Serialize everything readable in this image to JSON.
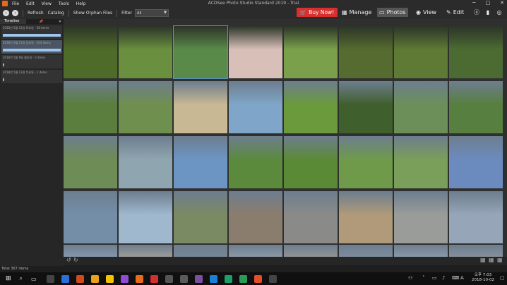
{
  "window": {
    "title": "ACDSee Photo Studio Standard 2019 - Trial",
    "menu": [
      "File",
      "Edit",
      "View",
      "Tools",
      "Help"
    ],
    "controls": [
      "─",
      "□",
      "✕"
    ]
  },
  "toolbar": {
    "refresh": "Refresh",
    "catalog": "Catalog",
    "orphan": "Show Orphan Files",
    "filter_label": "Filter",
    "filter_value": "All",
    "buy_now": "Buy Now!",
    "modes": [
      "Manage",
      "Photos",
      "View",
      "Edit"
    ],
    "active_mode": "Photos"
  },
  "panel": {
    "tab": "Timeline",
    "rows": [
      {
        "label": "2018년 5월 12일 토요일 - 58 items",
        "selected": false,
        "bar": "full"
      },
      {
        "label": "2018년 5월 13일 일요일 - 303 items",
        "selected": true,
        "bar": "full"
      },
      {
        "label": "2018년 5월 9일 월요일 - 5 items",
        "selected": false,
        "bar": "small"
      },
      {
        "label": "2018년 5월 13일 목요일 - 1 items",
        "selected": false,
        "bar": "small"
      }
    ]
  },
  "status": {
    "total": "Total 367 items"
  },
  "clock": {
    "time": "오후 7:03",
    "date": "2018-10-02"
  },
  "tray": {
    "lang": "A"
  },
  "thumb_colors": [
    [
      "#4f6b2a",
      "#6a8f3f",
      "#5a8a4a",
      "#d8c0b8",
      "#7aa04c",
      "#556b2f",
      "#5e7a35",
      "#4b6b32"
    ],
    [
      "#5b7d3d",
      "#6f8f4f",
      "#c9b894",
      "#7fa6c8",
      "#6a9a3b",
      "#3f5f2c",
      "#6c8f5a",
      "#577f3f"
    ],
    [
      "#6e8c55",
      "#8fa6b0",
      "#6c95c4",
      "#5c8a3c",
      "#5b8a36",
      "#6f9a4a",
      "#7a9f5a",
      "#6b8bbf"
    ],
    [
      "#748ea8",
      "#9fb8ce",
      "#7a8a63",
      "#8b7d6e",
      "#8a8a88",
      "#b09a7a",
      "#9a9c9a",
      "#96a6b8"
    ],
    [
      "#9aaec4",
      "#c8b8a0",
      "#7f8f9f",
      "#a8b0bb",
      "#b0a898",
      "#8a9aaa",
      "#a4b4c4",
      "#9aa0a8"
    ]
  ],
  "selected_thumb": [
    0,
    2
  ],
  "taskbar_apps": [
    "#444",
    "#2a6ed8",
    "#d04a1e",
    "#e8a21a",
    "#f4c300",
    "#8f4bd3",
    "#e86a1b",
    "#d03030",
    "#555",
    "#5a5a5a",
    "#7b4fa0",
    "#1b7fd8",
    "#1a9f6a",
    "#2a9a5a",
    "#e54d27",
    "#444"
  ]
}
